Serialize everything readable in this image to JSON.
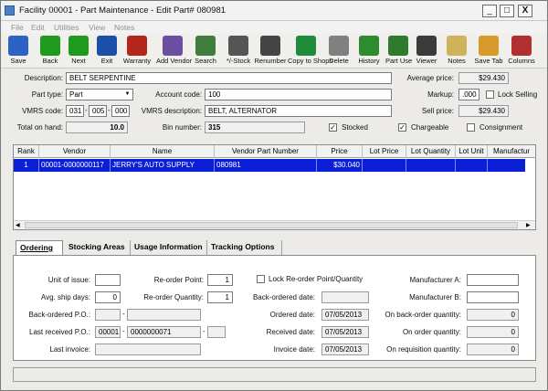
{
  "window": {
    "title": "Facility 00001 - Part Maintenance - Edit Part# 080981",
    "min": "_",
    "max": "□",
    "close": "X"
  },
  "menu": [
    "File",
    "Edit",
    "Utilities",
    "View",
    "Notes"
  ],
  "toolbar": [
    {
      "label": "Save",
      "icon": "save-icon",
      "color": "#2b63c4"
    },
    {
      "label": "Back",
      "icon": "back-arrow-icon",
      "color": "#1f9a1f"
    },
    {
      "label": "Next",
      "icon": "next-arrow-icon",
      "color": "#1f9a1f"
    },
    {
      "label": "Exit",
      "icon": "exit-icon",
      "color": "#1b4fa8"
    },
    {
      "label": "Warranty",
      "icon": "warranty-icon",
      "color": "#b3261e"
    },
    {
      "label": "Add Vendor",
      "icon": "add-vendor-icon",
      "color": "#6b4fa0"
    },
    {
      "label": "Search",
      "icon": "search-icon",
      "color": "#3f7d3f"
    },
    {
      "label": "*/-Stock",
      "icon": "stock-icon",
      "color": "#555555"
    },
    {
      "label": "Renumber",
      "icon": "renumber-icon",
      "color": "#444444"
    },
    {
      "label": "Copy to Shops",
      "icon": "copy-to-shops-icon",
      "color": "#1e8c3a"
    },
    {
      "label": "Delete",
      "icon": "trash-icon",
      "color": "#808080"
    },
    {
      "label": "History",
      "icon": "history-icon",
      "color": "#2e8b2e"
    },
    {
      "label": "Part Use",
      "icon": "part-use-icon",
      "color": "#2f7a2f"
    },
    {
      "label": "Viewer",
      "icon": "image-viewer-icon",
      "color": "#3a3a3a"
    },
    {
      "label": "Notes",
      "icon": "notes-icon",
      "color": "#d0b25a"
    },
    {
      "label": "Save Tab",
      "icon": "save-tab-icon",
      "color": "#d89a2a"
    },
    {
      "label": "Columns",
      "icon": "columns-icon",
      "color": "#b03030"
    }
  ],
  "form": {
    "description_label": "Description:",
    "description": "BELT SERPENTINE",
    "parttype_label": "Part type:",
    "parttype": "Part",
    "account_label": "Account code:",
    "account": "100",
    "vmrs_label": "VMRS code:",
    "vmrs1": "031",
    "vmrs2": "005",
    "vmrs3": "000",
    "vmrsdesc_label": "VMRS description:",
    "vmrsdesc": "BELT, ALTERNATOR",
    "onhand_label": "Total on hand:",
    "onhand": "10.0",
    "bin_label": "Bin number:",
    "bin": "315",
    "stocked_label": "Stocked",
    "stocked": "✓",
    "chargeable_label": "Chargeable",
    "chargeable": "✓",
    "consignment_label": "Consignment",
    "avgprice_label": "Average price:",
    "avgprice": "$29.430",
    "markup_label": "Markup:",
    "markup": ".000",
    "lockselling_label": "Lock Selling",
    "sellprice_label": "Sell price:",
    "sellprice": "$29.430"
  },
  "grid": {
    "headers": [
      "Rank",
      "Vendor",
      "Name",
      "Vendor Part Number",
      "Price",
      "Lot Price",
      "Lot Quantity",
      "Lot Unit",
      "Manufactur"
    ],
    "rows": [
      [
        "1",
        "00001-0000000117",
        "JERRY'S AUTO SUPPLY",
        "080981",
        "$30.040",
        "",
        "",
        "",
        ""
      ]
    ]
  },
  "tabs": [
    "Ordering",
    "Stocking Areas",
    "Usage Information",
    "Tracking Options"
  ],
  "ordering": {
    "unit_label": "Unit of issue:",
    "unit": "",
    "shipdays_label": "Avg. ship days:",
    "shipdays": "0",
    "bopo_label": "Back-ordered P.O.:",
    "bopo1": "",
    "bopo2": "",
    "lastpo_label": "Last received P.O.:",
    "lastpo1": "00001",
    "lastpo2": "0000000071",
    "lastpo3": "",
    "lastinv_label": "Last invoice:",
    "lastinv": "",
    "reorderpt_label": "Re-order Point:",
    "reorderpt": "1",
    "reorderqty_label": "Re-order Quantity:",
    "reorderqty": "1",
    "lockreorder_label": "Lock Re-order Point/Quantity",
    "bodate_label": "Back-ordered date:",
    "bodate": "",
    "orddate_label": "Ordered date:",
    "orddate": "07/05/2013",
    "recvdate_label": "Received date:",
    "recvdate": "07/05/2013",
    "invdate_label": "Invoice date:",
    "invdate": "07/05/2013",
    "mfga_label": "Manufacturer A:",
    "mfga": "",
    "mfgb_label": "Manufacturer B:",
    "mfgb": "",
    "boqty_label": "On back-order quantity:",
    "boqty": "0",
    "onord_label": "On order quantity:",
    "onord": "0",
    "onreq_label": "On requisition quantity:",
    "onreq": "0"
  },
  "status": ""
}
